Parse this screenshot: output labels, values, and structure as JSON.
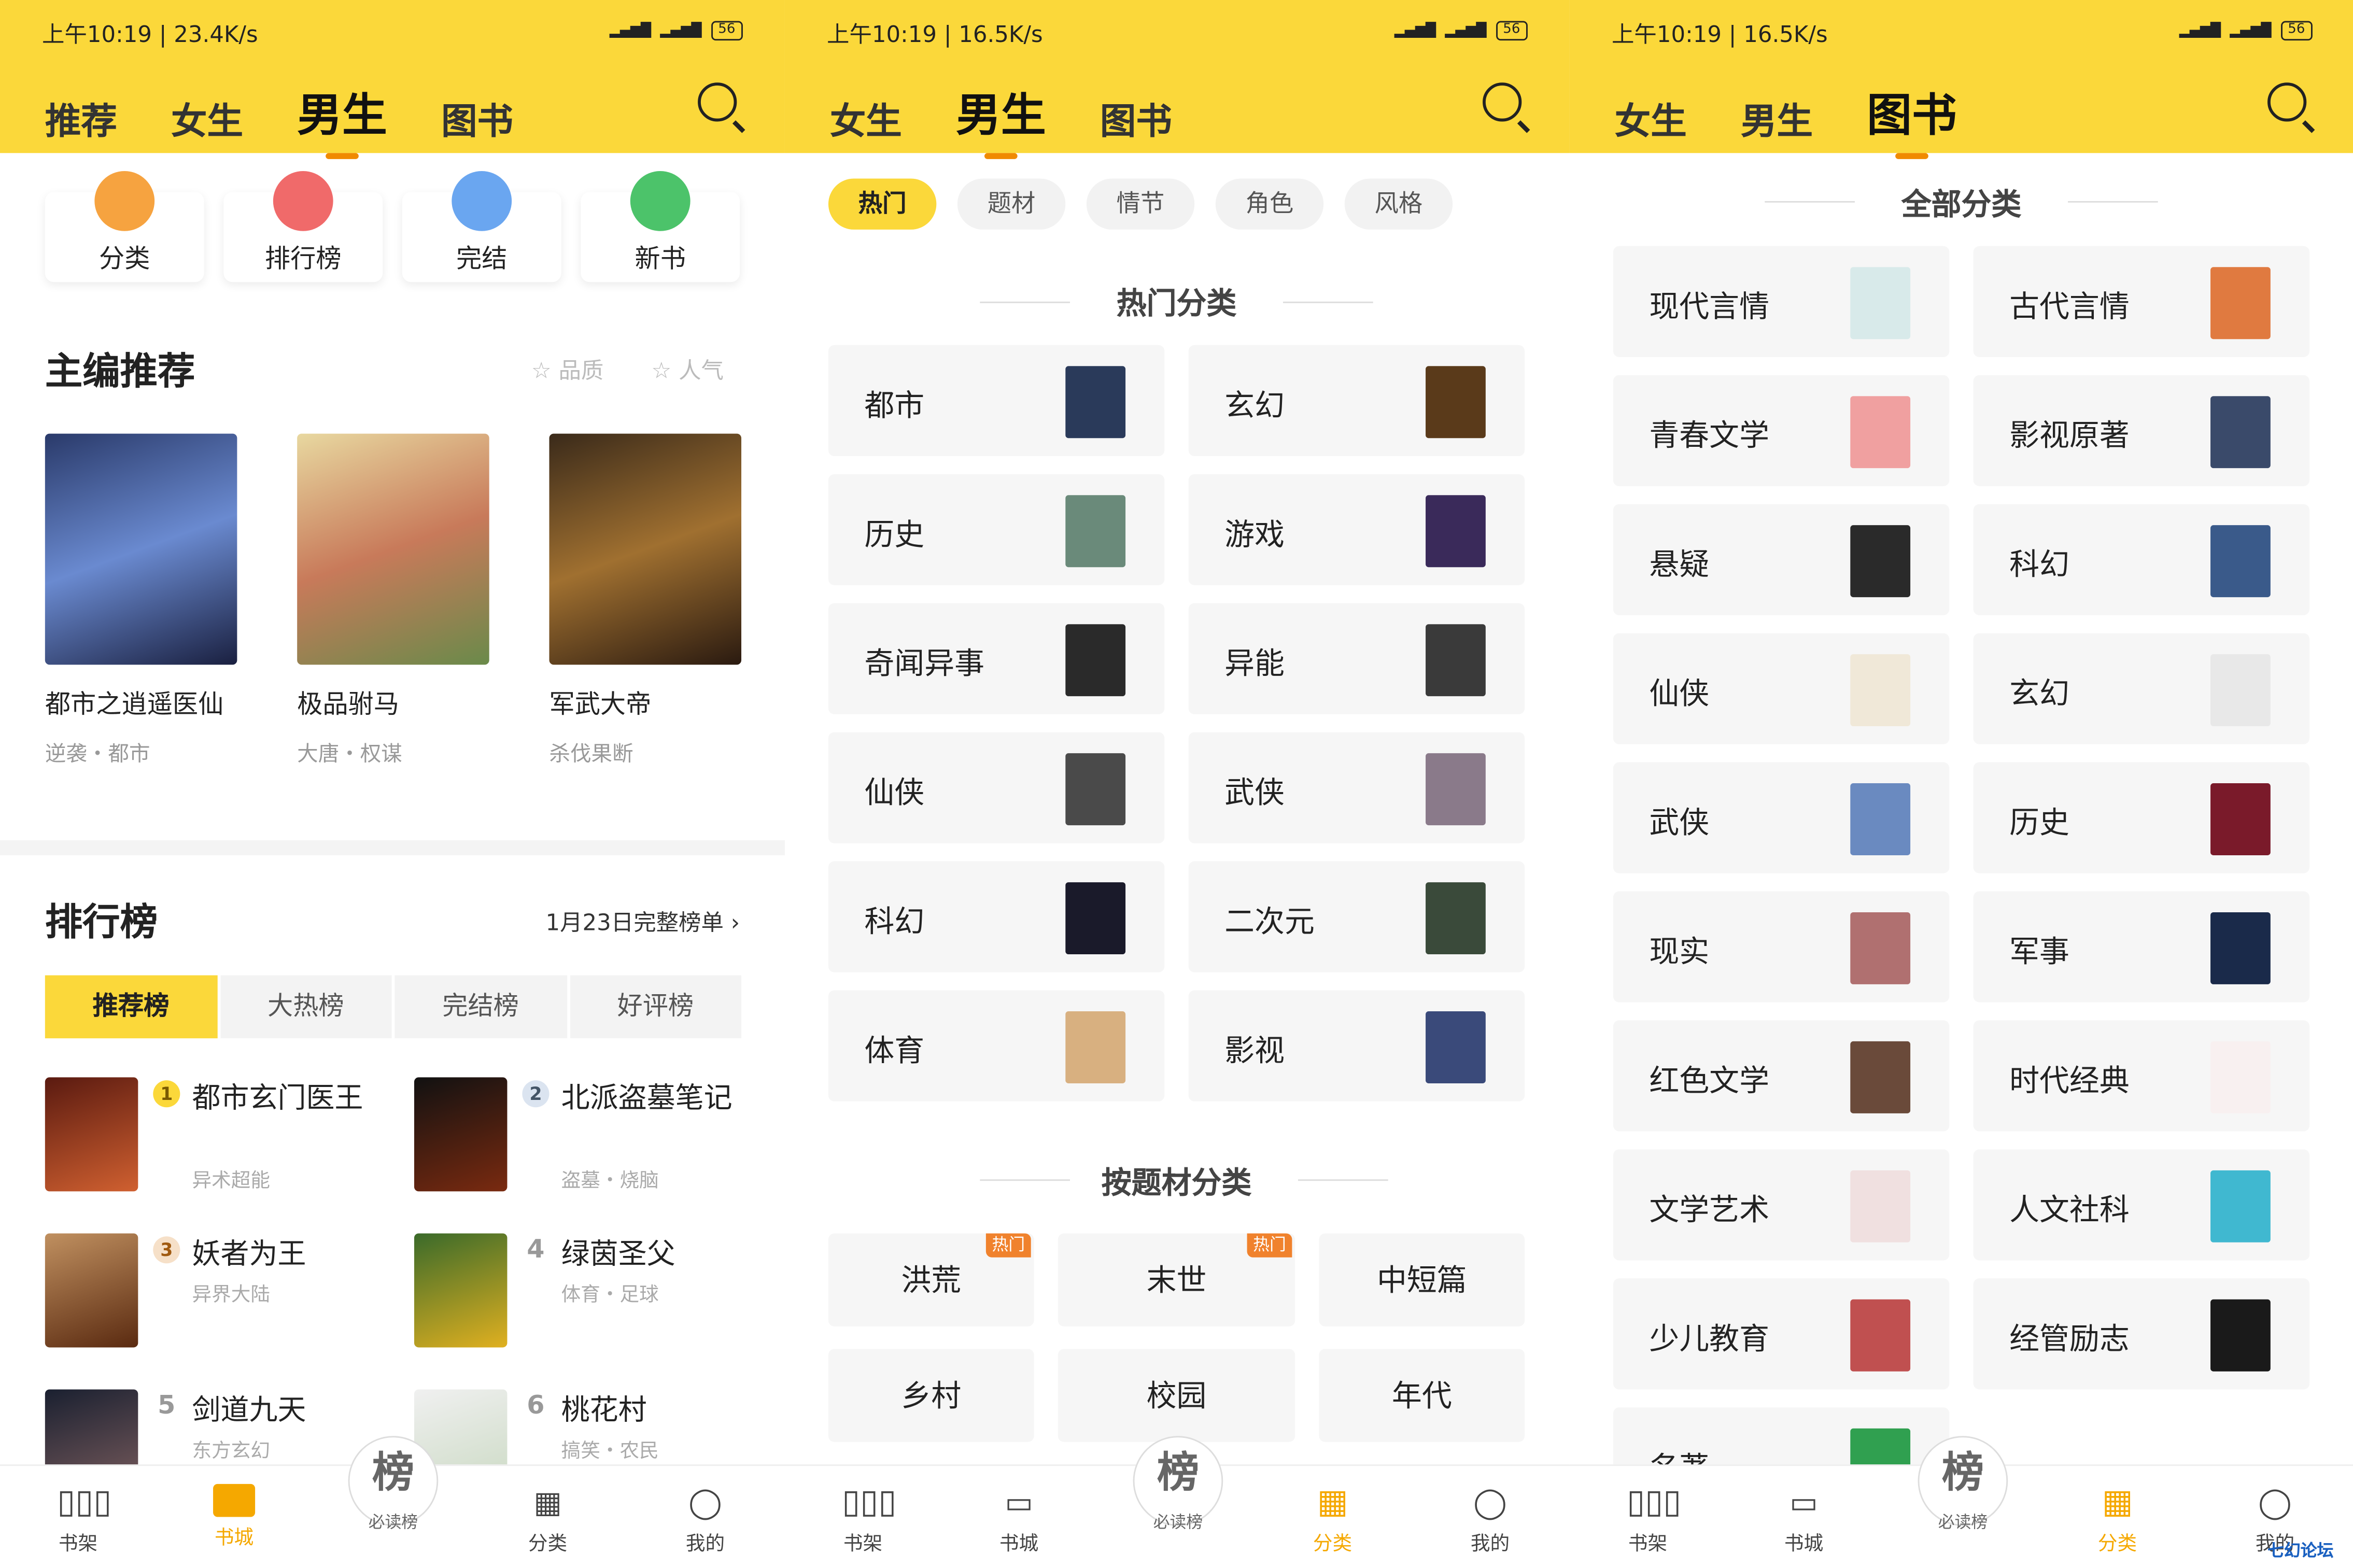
{
  "colors": {
    "brand": "#fbd83a",
    "accent": "#f08a00"
  },
  "panel1": {
    "status": "上午10:19 | 23.4K/s",
    "tabs": [
      "推荐",
      "女生",
      "男生",
      "图书"
    ],
    "quick": [
      "分类",
      "排行榜",
      "完结",
      "新书"
    ],
    "editor_title": "主编推荐",
    "quality": "品质",
    "popularity": "人气",
    "books": [
      {
        "title": "都市之逍遥医仙",
        "sub": "逆袭・都市"
      },
      {
        "title": "极品驸马",
        "sub": "大唐・权谋"
      },
      {
        "title": "军武大帝",
        "sub": "杀伐果断"
      }
    ],
    "rank_title": "排行榜",
    "rank_date": "1月23日完整榜单",
    "rank_tabs": [
      "推荐榜",
      "大热榜",
      "完结榜",
      "好评榜"
    ],
    "ranks": [
      {
        "n": "1",
        "title": "都市玄门医王",
        "sub": "异术超能"
      },
      {
        "n": "2",
        "title": "北派盗墓笔记",
        "sub": "盗墓・烧脑"
      },
      {
        "n": "3",
        "title": "妖者为王",
        "sub": "异界大陆"
      },
      {
        "n": "4",
        "title": "绿茵圣父",
        "sub": "体育・足球"
      },
      {
        "n": "5",
        "title": "剑道九天",
        "sub": "东方玄幻"
      },
      {
        "n": "6",
        "title": "桃花村",
        "sub": "搞笑・农民"
      }
    ]
  },
  "panel2": {
    "status": "上午10:19 | 16.5K/s",
    "tabs": [
      "女生",
      "男生",
      "图书"
    ],
    "chips": [
      "热门",
      "题材",
      "情节",
      "角色",
      "风格"
    ],
    "hot_head": "热门分类",
    "cats": [
      "都市",
      "玄幻",
      "历史",
      "游戏",
      "奇闻异事",
      "异能",
      "仙侠",
      "武侠",
      "科幻",
      "二次元",
      "体育",
      "影视"
    ],
    "topic_head": "按题材分类",
    "genres": [
      "洪荒",
      "末世",
      "中短篇",
      "乡村",
      "校园",
      "年代"
    ],
    "hot_badge": "热门"
  },
  "panel3": {
    "status": "上午10:19 | 16.5K/s",
    "tabs": [
      "女生",
      "男生",
      "图书"
    ],
    "head": "全部分类",
    "cats": [
      "现代言情",
      "古代言情",
      "青春文学",
      "影视原著",
      "悬疑",
      "科幻",
      "仙侠",
      "玄幻",
      "武侠",
      "历史",
      "现实",
      "军事",
      "红色文学",
      "时代经典",
      "文学艺术",
      "人文社科",
      "少儿教育",
      "经管励志",
      "名著"
    ]
  },
  "nav": {
    "shelf": "书架",
    "store": "书城",
    "rank_glyph": "榜",
    "rank": "必读榜",
    "cat": "分类",
    "me": "我的"
  },
  "watermark": "七幻论坛"
}
